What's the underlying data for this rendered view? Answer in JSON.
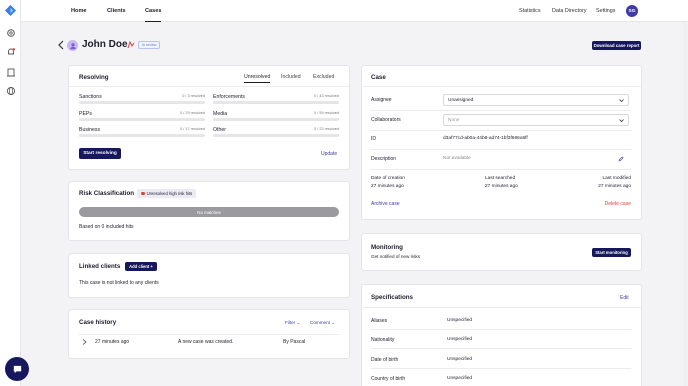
{
  "nav": {
    "home": "Home",
    "clients": "Clients",
    "cases": "Cases",
    "statistics": "Statistics",
    "data_directory": "Data Directory",
    "settings": "Settings",
    "avatar_initials": "SG"
  },
  "header": {
    "name": "John Doe",
    "version_badge": "In review",
    "download_button": "Download case report"
  },
  "resolving": {
    "title": "Resolving",
    "tabs": [
      "Unresolved",
      "Included",
      "Excluded"
    ],
    "categories": [
      {
        "label": "Sanctions",
        "count": "0 / 3 resolved"
      },
      {
        "label": "Enforcements",
        "count": "0 / 43 resolved"
      },
      {
        "label": "PEPs",
        "count": "0 / 29 resolved"
      },
      {
        "label": "Media",
        "count": "0 / 59 resolved"
      },
      {
        "label": "Business",
        "count": "0 / 17 resolved"
      },
      {
        "label": "Other",
        "count": "0 / 22 resolved"
      }
    ],
    "start_button": "Start resolving",
    "update_link": "Update"
  },
  "risk": {
    "title": "Risk Classification",
    "badge": "Unresolved high risk hits",
    "bar_text": "No matches",
    "footnote": "Based on 0 included hits"
  },
  "linked": {
    "title": "Linked clients",
    "add_button": "Add client +",
    "empty_text": "This case is not linked to any clients"
  },
  "history": {
    "title": "Case history",
    "filter": "Filter",
    "comment": "Comment",
    "rows": [
      {
        "time": "27 minutes ago",
        "event": "A new case was created.",
        "by": "By Pascal"
      }
    ]
  },
  "case": {
    "title": "Case",
    "assignee_label": "Assignee",
    "assignee_value": "Unassigned",
    "collaborators_label": "Collaborators",
    "collaborators_value": "None",
    "id_label": "ID",
    "id_value": "d3af77cd-ab0a-44b8-ad74-1bf3f686a5ff",
    "description_label": "Description",
    "description_value": "Not available",
    "date_creation_label": "Date of creation",
    "date_creation_value": "27 minutes ago",
    "last_searched_label": "Last searched",
    "last_searched_value": "27 minutes ago",
    "last_modified_label": "Last modified",
    "last_modified_value": "27 minutes ago",
    "archive_link": "Archive case",
    "delete_link": "Delete case"
  },
  "monitoring": {
    "title": "Monitoring",
    "subtitle": "Get notified of new risks",
    "button": "Start monitoring"
  },
  "specs": {
    "title": "Specifications",
    "edit": "Edit",
    "rows": [
      {
        "label": "Aliases",
        "value": "Unspecified"
      },
      {
        "label": "Nationality",
        "value": "Unspecified"
      },
      {
        "label": "Date of birth",
        "value": "Unspecified"
      },
      {
        "label": "Country of birth",
        "value": "Unspecified"
      }
    ]
  },
  "colors": {
    "primary": "#17175e",
    "accent": "#3f3aa8",
    "danger": "#d9453c"
  }
}
